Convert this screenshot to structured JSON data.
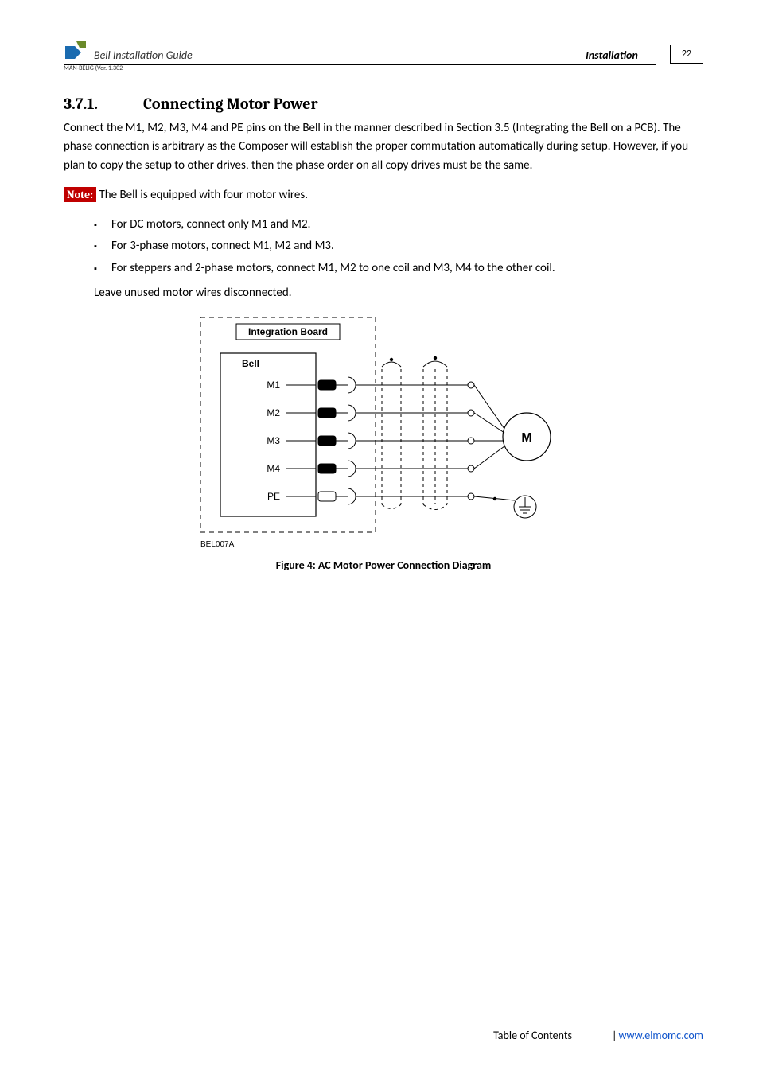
{
  "header": {
    "guide_title": "Bell Installation Guide",
    "section_label": "Installation",
    "page_number": "22",
    "doc_id": "MAN-BELIG (Ver. 1.302"
  },
  "section": {
    "number": "3.7.1.",
    "title": "Connecting Motor Power"
  },
  "paragraphs": {
    "intro": "Connect the M1, M2, M3, M4 and PE pins on the Bell in the manner described in Section 3.5 (Integrating the Bell on a PCB). The phase connection is arbitrary as the Composer will establish the proper commutation automatically during setup. However, if you plan to copy the setup to other drives, then the phase order on all copy drives must be the same.",
    "note_label": "Note:",
    "note_text": " The Bell is equipped with four motor wires.",
    "bullets": [
      "For DC motors, connect only M1 and M2.",
      "For 3-phase motors, connect M1, M2 and M3.",
      "For steppers and 2-phase motors, connect M1, M2 to one coil and M3, M4 to the other coil."
    ],
    "after_list": "Leave unused motor wires disconnected."
  },
  "diagram": {
    "board_label": "Integration Board",
    "device_label": "Bell",
    "pins": [
      "M1",
      "M2",
      "M3",
      "M4",
      "PE"
    ],
    "motor_label": "M",
    "ref": "BEL007A"
  },
  "figure_caption": "Figure 4: AC Motor Power Connection Diagram",
  "footer": {
    "toc": "Table of Contents",
    "link": "www.elmomc.com"
  }
}
